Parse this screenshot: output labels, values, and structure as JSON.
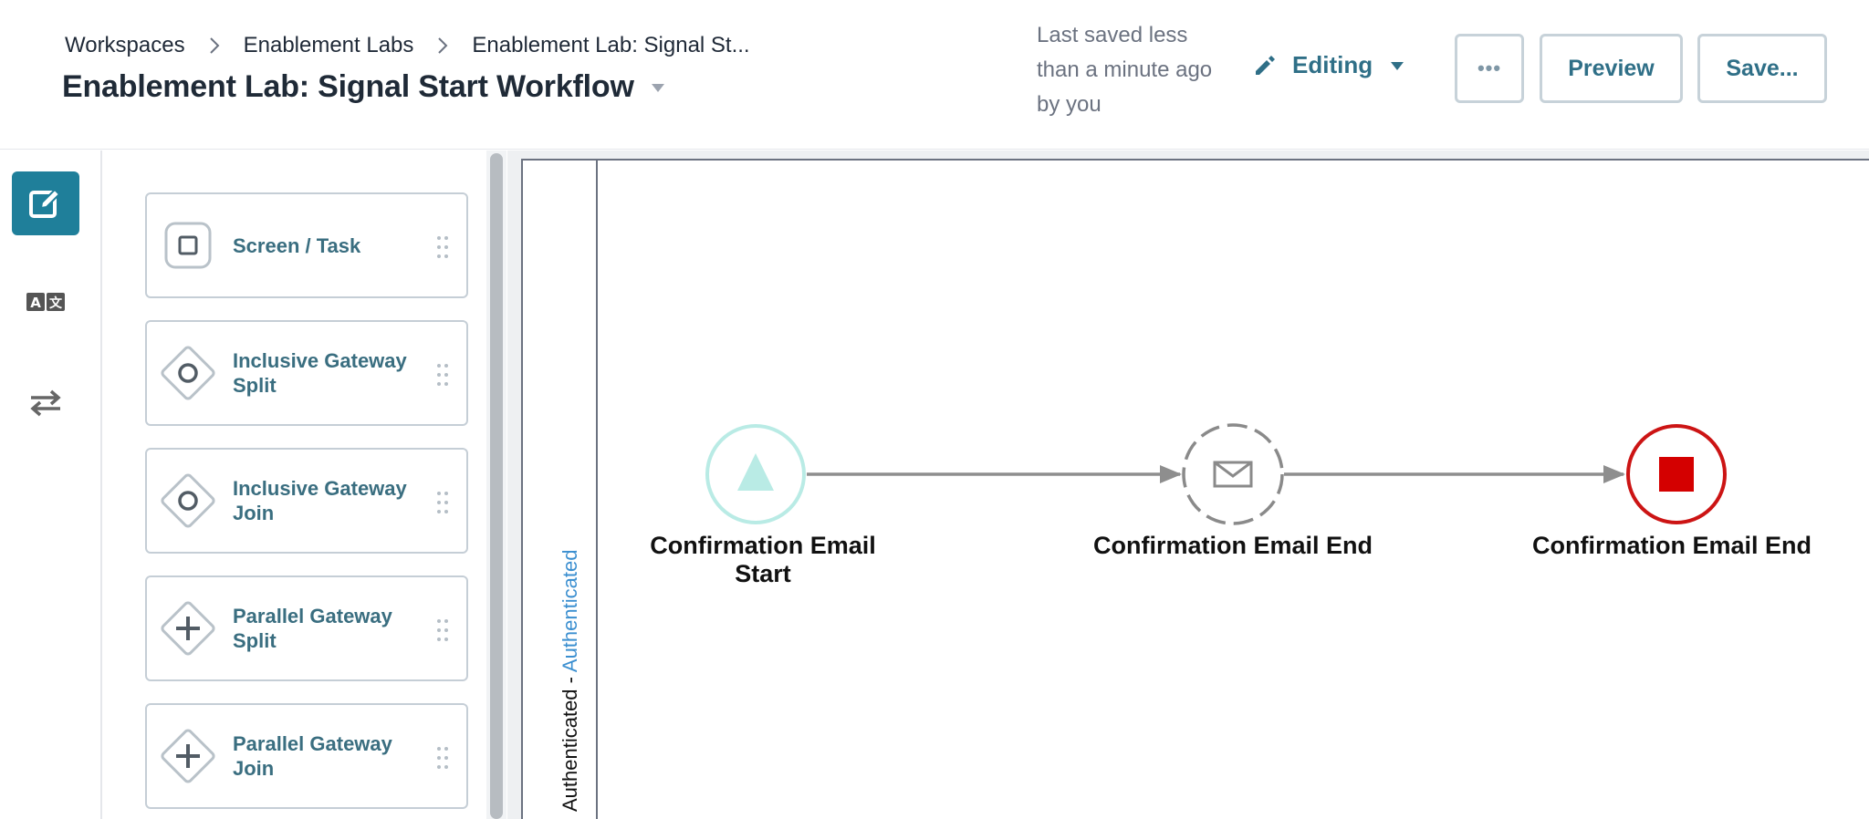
{
  "breadcrumb": {
    "items": [
      "Workspaces",
      "Enablement Labs",
      "Enablement Lab: Signal St..."
    ]
  },
  "page": {
    "title": "Enablement Lab: Signal Start Workflow"
  },
  "header": {
    "save_status": "Last saved less than a minute ago by you",
    "mode_label": "Editing",
    "more_label": "•••",
    "preview_label": "Preview",
    "save_label": "Save..."
  },
  "rail": {
    "items": [
      {
        "icon": "edit-icon",
        "active": true
      },
      {
        "icon": "translate-icon",
        "active": false
      },
      {
        "icon": "swap-arrows-icon",
        "active": false
      }
    ]
  },
  "palette": {
    "items": [
      {
        "label": "Screen / Task",
        "icon": "task-square-icon"
      },
      {
        "label": "Inclusive Gateway Split",
        "icon": "inclusive-gateway-icon"
      },
      {
        "label": "Inclusive Gateway Join",
        "icon": "inclusive-gateway-icon"
      },
      {
        "label": "Parallel Gateway Split",
        "icon": "parallel-gateway-icon"
      },
      {
        "label": "Parallel Gateway Join",
        "icon": "parallel-gateway-icon"
      }
    ]
  },
  "lane": {
    "label_main": "Authenticated - ",
    "label_accent": "Authenticated"
  },
  "diagram": {
    "nodes": [
      {
        "label": "Confirmation Email Start",
        "type": "signal-start-event"
      },
      {
        "label": "Confirmation Email End",
        "type": "message-intermediate-event"
      },
      {
        "label": "Confirmation Email End",
        "type": "end-event"
      }
    ]
  },
  "colors": {
    "accent": "#1f7f9a",
    "link": "#2f6f87",
    "start_event": "#b9ebe5",
    "end_event": "#d40000"
  }
}
